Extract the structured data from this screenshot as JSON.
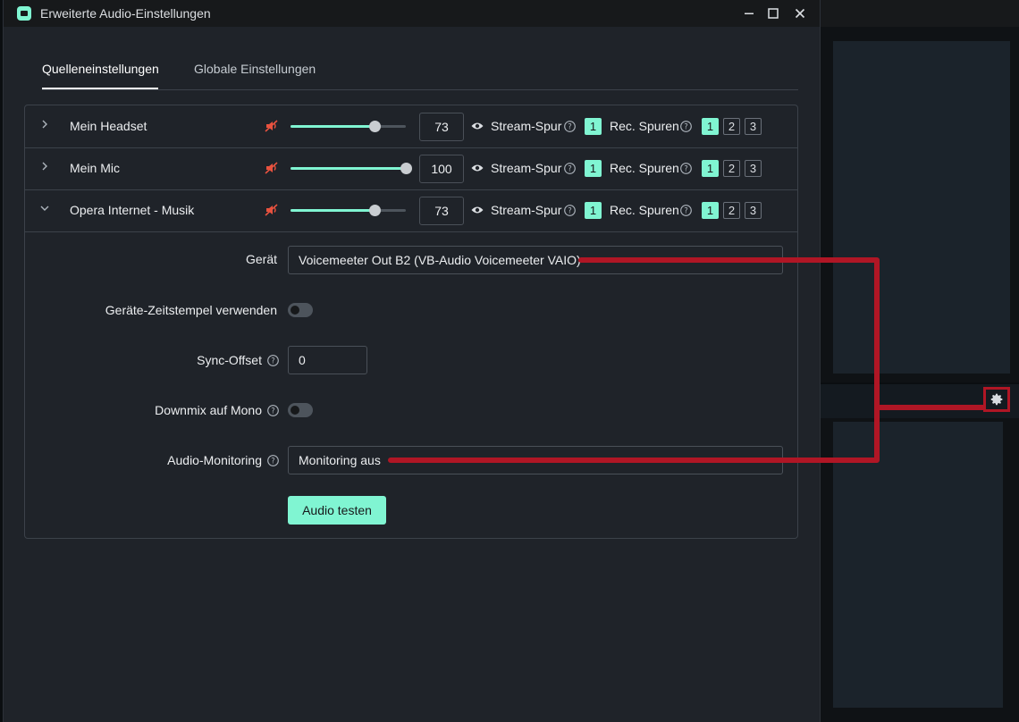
{
  "window": {
    "title": "Erweiterte Audio-Einstellungen",
    "controls": [
      "minimize-icon",
      "maximize-icon",
      "close-icon"
    ]
  },
  "tabs": [
    {
      "label": "Quelleneinstellungen",
      "active": true
    },
    {
      "label": "Globale Einstellungen",
      "active": false
    }
  ],
  "labels": {
    "stream_track": "Stream-Spur",
    "rec_tracks": "Rec. Spuren"
  },
  "sources": [
    {
      "name": "Mein Headset",
      "expanded": false,
      "volume": "73",
      "volume_fraction": 0.73,
      "stream_track": "1",
      "rec_tracks": [
        "1",
        "2",
        "3"
      ],
      "rec_active": [
        true,
        false,
        false
      ]
    },
    {
      "name": "Mein Mic",
      "expanded": false,
      "volume": "100",
      "volume_fraction": 1.0,
      "stream_track": "1",
      "rec_tracks": [
        "1",
        "2",
        "3"
      ],
      "rec_active": [
        true,
        false,
        false
      ]
    },
    {
      "name": "Opera Internet - Musik",
      "expanded": true,
      "volume": "73",
      "volume_fraction": 0.73,
      "stream_track": "1",
      "rec_tracks": [
        "1",
        "2",
        "3"
      ],
      "rec_active": [
        true,
        false,
        false
      ]
    }
  ],
  "details": {
    "device_label": "Gerät",
    "device_value": "Voicemeeter Out B2 (VB-Audio Voicemeeter VAIO)",
    "timestamps_label": "Geräte-Zeitstempel verwenden",
    "timestamps_on": false,
    "sync_offset_label": "Sync-Offset",
    "sync_offset_value": "0",
    "downmix_label": "Downmix auf Mono",
    "downmix_on": false,
    "monitoring_label": "Audio-Monitoring",
    "monitoring_value": "Monitoring aus",
    "test_button": "Audio testen"
  },
  "colors": {
    "accent": "#80f5d2",
    "muted_icon": "#e8523f",
    "annotation": "#b01625"
  }
}
